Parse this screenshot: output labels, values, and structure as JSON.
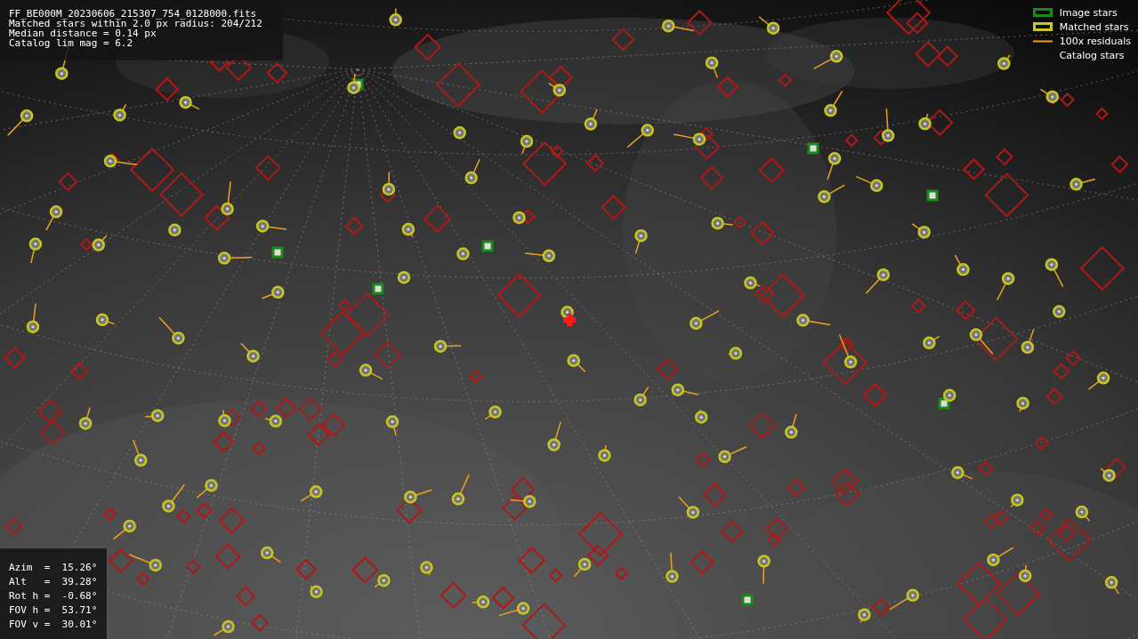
{
  "info_box": {
    "lines": [
      "FF_BE000M_20230606_215307_754_0128000.fits",
      "Matched stars within 2.0 px radius: 204/212",
      "Median distance = 0.14 px",
      "Catalog lim mag = 6.2"
    ]
  },
  "legend": [
    {
      "label": "Image stars",
      "color": "#1a8a1a"
    },
    {
      "kind": "matched",
      "label": "Matched stars",
      "color": "#c8c81e"
    },
    {
      "kind": "residual",
      "label": "100x residuals",
      "color": "#f0a020"
    },
    {
      "kind": "catalog",
      "label": "Catalog stars"
    }
  ],
  "pointing_box": {
    "lines": [
      "Azim  =  15.26°",
      "Alt   =  39.28°",
      "Rot h =  -0.68°",
      "FOV h =  53.71°",
      "FOV v =  30.01°"
    ]
  }
}
